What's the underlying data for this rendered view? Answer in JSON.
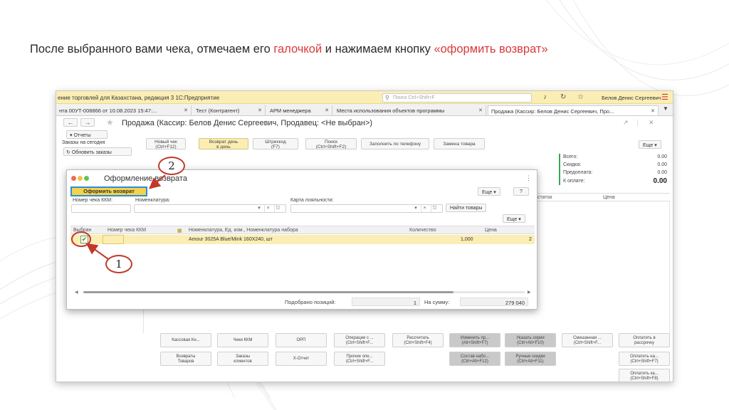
{
  "instruction": {
    "part1": "После выбранного вами чека, отмечаем его ",
    "highlight1": "галочкой",
    "part2": " и нажимаем кнопку ",
    "highlight2": "«оформить возврат»"
  },
  "app": {
    "title": "ение торговлей для Казахстана, редакция 3 1С:Предприятие",
    "search_placeholder": "Поиск Ctrl+Shift+F",
    "user": "Белов Денис Сергеевич"
  },
  "tabs": [
    {
      "label": "нта 00УТ-008866 от 10.08.2023 15:47:..."
    },
    {
      "label": "Тест (Контрагент)"
    },
    {
      "label": "АРМ менеджера"
    },
    {
      "label": "Места использования объектов программы"
    },
    {
      "label": "Продажа (Кассир: Белов Денис Сергеевич, Про..."
    }
  ],
  "document": {
    "title": "Продажа (Кассир: Белов Денис Сергеевич, Продавец: <Не выбран>)"
  },
  "left_panel": {
    "reports": "Отчеты",
    "tab": "Заказы на сегодня",
    "refresh": "Обновить заказы"
  },
  "toolbar": [
    {
      "line1": "Новый чек",
      "line2": "(Ctrl+F12)"
    },
    {
      "line1": "Возврат день",
      "line2": "в день"
    },
    {
      "line1": "Штрихкод",
      "line2": "(F7)"
    },
    {
      "line1": "Поиск",
      "line2": "(Ctrl+Shift+F2)"
    },
    {
      "line1": "Заполнить по телефону",
      "line2": ""
    },
    {
      "line1": "Замена товара",
      "line2": ""
    }
  ],
  "summary": {
    "more": "Еще",
    "rows": [
      {
        "label": "Всего:",
        "value": "0.00"
      },
      {
        "label": "Скидка:",
        "value": "0.00"
      },
      {
        "label": "Предоплата:",
        "value": "0.00"
      },
      {
        "label": "К оплате:",
        "value": "0.00"
      }
    ]
  },
  "bg_table": {
    "col1": "статок",
    "col2": "Цена"
  },
  "bottom_buttons": [
    {
      "line1": "Кассовая Кн...",
      "line2": "",
      "dark": false
    },
    {
      "line1": "Чеки ККМ",
      "line2": "",
      "dark": false
    },
    {
      "line1": "ОРП",
      "line2": "",
      "dark": false
    },
    {
      "line1": "Операции с ...",
      "line2": "(Ctrl+Shift+F...",
      "dark": false
    },
    {
      "line1": "Рассчитать",
      "line2": "(Ctrl+Shift+F4)",
      "dark": false
    },
    {
      "line1": "Изменить пр...",
      "line2": "(Alt+Shift+F7)",
      "dark": true
    },
    {
      "line1": "Указать серии",
      "line2": "(Ctrl+Alt+F10)",
      "dark": true
    },
    {
      "line1": "Смешанная ...",
      "line2": "(Ctrl+Shift+F...",
      "dark": false
    },
    {
      "line1": "Оплатить в",
      "line2": "рассрочку",
      "dark": false
    },
    {
      "line1": "Возвраты",
      "line2": "Товаров",
      "dark": false
    },
    {
      "line1": "Заказы",
      "line2": "клиентов",
      "dark": false
    },
    {
      "line1": "Х-Отчет",
      "line2": "",
      "dark": false
    },
    {
      "line1": "Прочие опе...",
      "line2": "(Ctrl+Shift+F...",
      "dark": false
    },
    {
      "line1": "Состав набо...",
      "line2": "(Ctrl+Alt+F12)",
      "dark": true
    },
    {
      "line1": "Ручные скидки",
      "line2": "(Ctrl+Alt+F11)",
      "dark": true
    },
    {
      "line1": "Оплатить на...",
      "line2": "(Ctrl+Shift+F7)",
      "dark": false
    },
    {
      "line1": "Оплатить ка...",
      "line2": "(Ctrl+Shift+F8)",
      "dark": false
    }
  ],
  "dialog": {
    "title": "Оформление возврата",
    "return_button": "Оформить возврат",
    "more": "Еще",
    "help": "?",
    "filters": {
      "receipt_label": "Номер чека ККМ:",
      "nomenclature_label": "Номенклатура:",
      "loyalty_label": "Карта лояльности:",
      "find_button": "Найти товары"
    },
    "more2": "Еще",
    "columns": [
      "Выбран",
      "Номер чека ККМ",
      "Номенклатура, Ед. изм., Номенклатура набора",
      "Количество",
      "Цена"
    ],
    "rows": [
      {
        "selected": true,
        "receipt": "",
        "item": "Amour 3025A Blue/Mink 160X240, шт",
        "qty": "1,000",
        "price": "2"
      }
    ],
    "footer": {
      "count_label": "Подобрано позиций:",
      "count": "1",
      "sum_label": "На сумму:",
      "sum": "279 040"
    }
  },
  "callouts": [
    "1",
    "2"
  ],
  "colors": {
    "accent_red": "#d9383a",
    "header_yellow": "#fbeeb4",
    "button_yellow": "#f4d14e",
    "focus_blue": "#2b8fd6"
  }
}
